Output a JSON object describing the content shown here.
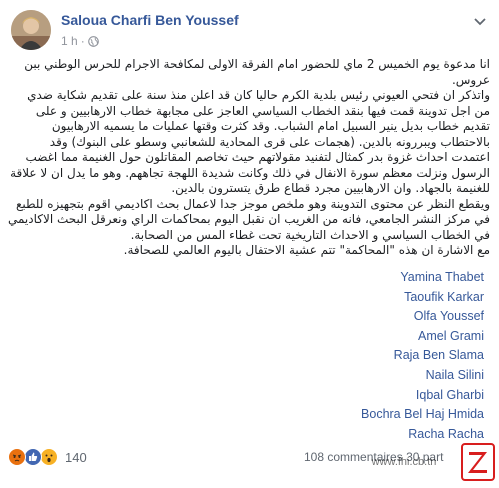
{
  "post": {
    "author": "Saloua Charfi Ben Youssef",
    "time": "1 h",
    "visibility_icon": "globe-icon",
    "menu_icon": "chevron-down-icon",
    "paragraphs": [
      "انا مدعوة يوم الخميس 2 ماي للحضور امام الفرقة الاولى لمكافحة الاجرام للحرس الوطني ببن عروس.",
      "واتذكر ان فتحي العيوني رئيس بلدية الكرم حاليا كان قد اعلن منذ سنة على تقديم شكاية ضدي من اجل تدوينة قمت فيها بنقد الخطاب السياسي العاجز على مجابهة خطاب الارهابيين و على تقديم خطاب بديل ينير السبيل امام الشباب. وقد كثرت وقتها عمليات ما يسميه الارهابيون بالاحتطاب ويبررونه بالدين. (هجمات على قرى المحادية للشعانبي وسطو على البنوك) وقد اعتمدت احداث غزوة بدر كمثال لتفنيد مقولاتهم حيث تخاصم المقاتلون حول الغنيمة مما اغضب الرسول ونزلت معظم سورة الانفال في ذلك وكانت شديدة اللهجة تجاههم. وهو ما يدل ان لا علاقة للغنيمة بالجهاد. وان الارهابيين مجرد قطاع طرق يتسترون بالدين.",
      "ويقطع النظر عن محتوى التدوينة وهو ملخص موجز جدا لاعمال بحث اكاديمي اقوم بتجهيزه للطبع في مركز النشر الجامعي، فانه من الغريب ان نقبل اليوم بمحاكمات الراي ونعرقل البحث الاكاديمي في الخطاب السياسي و الاحداث التاريخية تحت غطاء المس من الصحابة.",
      "مع الاشارة ان هذه \"المحاكمة\" تتم عشية الاحتفال باليوم العالمي للصحافة."
    ],
    "tagged_names": [
      "Yamina Thabet",
      "Taoufik Karkar",
      "Olfa Youssef",
      "Amel Grami",
      "Raja Ben Slama",
      "Naila Silini",
      "Iqbal Gharbi",
      "Bochra Bel Haj Hmida",
      "Racha Racha"
    ]
  },
  "footer": {
    "reaction_icons": [
      "angry-reaction-icon",
      "like-reaction-icon",
      "wow-reaction-icon"
    ],
    "reaction_count": "140",
    "comments": "108 commentaires",
    "shares": "30 part"
  },
  "overlay": {
    "watermark_text": "www.fhi.cb.tn",
    "brand_logo_icon": "z-brand-logo-icon"
  },
  "colors": {
    "link": "#365899",
    "text": "#1c1e21",
    "meta": "#90949c",
    "like": "#4267b2",
    "angry": "#e9710f",
    "wow": "#f7b125",
    "brand": "#d81e1e"
  }
}
